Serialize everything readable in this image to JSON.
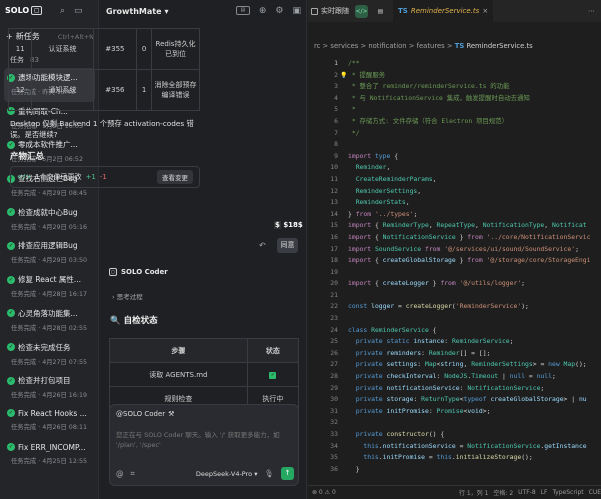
{
  "sidebar": {
    "brand": "SOLO",
    "new_task": "新任务",
    "new_task_shortcut": "Ctrl+Alt+N",
    "tasks_label": "任务",
    "tasks_count": "83",
    "tasks": [
      {
        "title": "遗场功能模块逻...",
        "sub": "任务完成 · 昨天 13:48"
      },
      {
        "title": "重构同取-Ch...",
        "sub": "任务完成 · 5月2日 16:03"
      },
      {
        "title": "零成本软件推广...",
        "sub": "任务完成 · 5月2日 06:52"
      },
      {
        "title": "查找右侧边栏Bug",
        "sub": "任务完成 · 4月29日 08:45"
      },
      {
        "title": "检查成就中心Bug",
        "sub": "任务完成 · 4月29日 05:16"
      },
      {
        "title": "排查应用逻辑Bug",
        "sub": "任务完成 · 4月29日 03:50"
      },
      {
        "title": "修复 React 属性...",
        "sub": "任务完成 · 4月28日 16:17"
      },
      {
        "title": "心灵角落功能集...",
        "sub": "任务完成 · 4月28日 02:55"
      },
      {
        "title": "检查未完成任务",
        "sub": "任务完成 · 4月27日 07:55"
      },
      {
        "title": "检查并打包项目",
        "sub": "任务完成 · 4月26日 16:19"
      },
      {
        "title": "Fix React Hooks ...",
        "sub": "任务完成 · 4月26日 08:11"
      },
      {
        "title": "Fix ERR_INCOMP...",
        "sub": "任务完成 · 4月25日 12:55"
      }
    ]
  },
  "chat": {
    "title": "GrowthMate",
    "table1": [
      [
        "11",
        "认证系统",
        "#355",
        "0",
        "Redis持久化已到位"
      ],
      [
        "12",
        "通知系统",
        "#356",
        "1",
        "消除全部预存编译错误"
      ]
    ],
    "note": "Desktop 仅剩 Backend 1 个预存 activation-codes 错误。是否继续?",
    "summary_title": "产物汇总",
    "changes": {
      "label": "1个文件已更改",
      "plus": "+1",
      "minus": "-1",
      "view": "查看变更"
    },
    "dollar": "$18$",
    "agree": "同意",
    "coder_name": "SOLO Coder",
    "thinking": "思考过程",
    "self_title": "自检状态",
    "table2": {
      "headers": [
        "步骤",
        "状态"
      ],
      "rows": [
        [
          "读取 AGENTS.md",
          "✓"
        ],
        [
          "规则检查",
          "执行中"
        ]
      ]
    },
    "composer": {
      "who": "@SOLO Coder",
      "placeholder": "您正在与 SOLO Coder 聊天。输入 '/' 获取更多能力，如 '/plan', '/spec'",
      "model": "DeepSeek-V4-Pro"
    }
  },
  "editor": {
    "realtime_label": "实时跟随",
    "file_tab": "ReminderService.ts",
    "breadcrumb": [
      "rc",
      "services",
      "notification",
      "features",
      "ReminderService.ts"
    ],
    "lines": [
      {
        "n": "1",
        "t": "/**"
      },
      {
        "n": "2",
        "t": " * 提醒服务"
      },
      {
        "n": "3",
        "t": " * 整合了 reminder/reminderService.ts 的功能"
      },
      {
        "n": "4",
        "t": " * 与 NotificationService 集成，触发提醒时自动去通知"
      },
      {
        "n": "5",
        "t": " *"
      },
      {
        "n": "6",
        "t": " * 存储方式: 文件存储（符合 Electron 项目规范）"
      },
      {
        "n": "7",
        "t": " */"
      },
      {
        "n": "8",
        "t": ""
      },
      {
        "n": "9",
        "t": "import type {"
      },
      {
        "n": "10",
        "t": "  Reminder,"
      },
      {
        "n": "11",
        "t": "  CreateReminderParams,"
      },
      {
        "n": "12",
        "t": "  ReminderSettings,"
      },
      {
        "n": "13",
        "t": "  ReminderStats,"
      },
      {
        "n": "14",
        "t": "} from '../types';"
      },
      {
        "n": "15",
        "t": "import { ReminderType, RepeatType, NotificationType, Notificat"
      },
      {
        "n": "16",
        "t": "import { NotificationService } from '../core/NotificationServic"
      },
      {
        "n": "17",
        "t": "import SoundService from '@/services/ui/sound/SoundService';"
      },
      {
        "n": "18",
        "t": "import { createGlobalStorage } from '@/storage/core/StorageEngi"
      },
      {
        "n": "19",
        "t": ""
      },
      {
        "n": "20",
        "t": "import { createLogger } from '@/utils/logger';"
      },
      {
        "n": "21",
        "t": ""
      },
      {
        "n": "22",
        "t": "const logger = createLogger('ReminderService');"
      },
      {
        "n": "23",
        "t": ""
      },
      {
        "n": "24",
        "t": "class ReminderService {"
      },
      {
        "n": "25",
        "t": "  private static instance: ReminderService;"
      },
      {
        "n": "26",
        "t": "  private reminders: Reminder[] = [];"
      },
      {
        "n": "27",
        "t": "  private settings: Map<string, ReminderSettings> = new Map();"
      },
      {
        "n": "28",
        "t": "  private checkInterval: NodeJS.Timeout | null = null;"
      },
      {
        "n": "29",
        "t": "  private notificationService: NotificationService;"
      },
      {
        "n": "30",
        "t": "  private storage: ReturnType<typeof createGlobalStorage> | nu"
      },
      {
        "n": "31",
        "t": "  private initPromise: Promise<void>;"
      },
      {
        "n": "32",
        "t": ""
      },
      {
        "n": "33",
        "t": "  private constructor() {"
      },
      {
        "n": "34",
        "t": "    this.notificationService = NotificationService.getInstance"
      },
      {
        "n": "35",
        "t": "    this.initPromise = this.initializeStorage();"
      },
      {
        "n": "36",
        "t": "  }"
      }
    ],
    "status": {
      "pos": "行 1，列 1",
      "spaces": "空格: 2",
      "enc": "UTF-8",
      "eol": "LF",
      "lang": "TypeScript",
      "mode": "CUE"
    }
  }
}
